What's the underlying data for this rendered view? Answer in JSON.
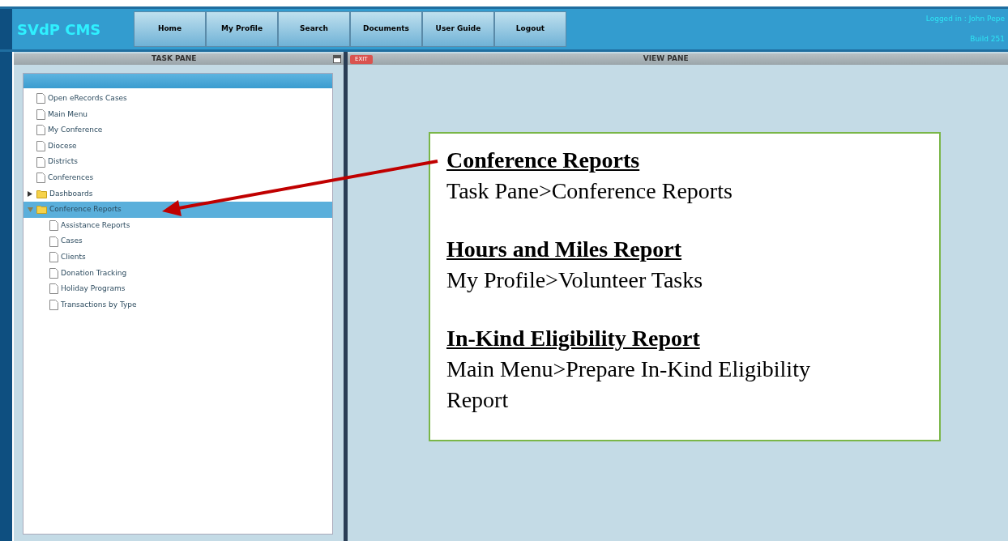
{
  "header": {
    "logo": "SVdP CMS",
    "nav": [
      "Home",
      "My Profile",
      "Search",
      "Documents",
      "User Guide",
      "Logout"
    ],
    "logged_in": "Logged in : John Pepe",
    "build": "Build 251"
  },
  "task_pane": {
    "title": "TASK PANE",
    "tree": [
      {
        "kind": "file",
        "label": "Open eRecords Cases",
        "selected": false
      },
      {
        "kind": "file",
        "label": "Main Menu",
        "selected": false
      },
      {
        "kind": "file",
        "label": "My Conference",
        "selected": false
      },
      {
        "kind": "file",
        "label": "Diocese",
        "selected": false
      },
      {
        "kind": "file",
        "label": "Districts",
        "selected": false
      },
      {
        "kind": "file",
        "label": "Conferences",
        "selected": false
      },
      {
        "kind": "folder",
        "label": "Dashboards",
        "expanded": false,
        "selected": false
      },
      {
        "kind": "folder",
        "label": "Conference Reports",
        "expanded": true,
        "selected": true,
        "children": [
          {
            "kind": "file",
            "label": "Assistance Reports",
            "selected": false
          },
          {
            "kind": "file",
            "label": "Cases",
            "selected": false
          },
          {
            "kind": "file",
            "label": "Clients",
            "selected": false
          },
          {
            "kind": "file",
            "label": "Donation Tracking",
            "selected": false
          },
          {
            "kind": "file",
            "label": "Holiday Programs",
            "selected": false
          },
          {
            "kind": "file",
            "label": "Transactions by Type",
            "selected": false
          }
        ]
      }
    ]
  },
  "view_pane": {
    "exit": "EXIT",
    "title": "VIEW PANE"
  },
  "callout": {
    "sections": [
      {
        "heading": "Conference Reports",
        "lines": [
          "Task Pane>Conference Reports"
        ]
      },
      {
        "heading": "Hours and Miles Report",
        "lines": [
          "My Profile>Volunteer Tasks"
        ]
      },
      {
        "heading": "In-Kind Eligibility Report",
        "lines": [
          "Main Menu>Prepare In-Kind Eligibility Report"
        ]
      }
    ]
  }
}
